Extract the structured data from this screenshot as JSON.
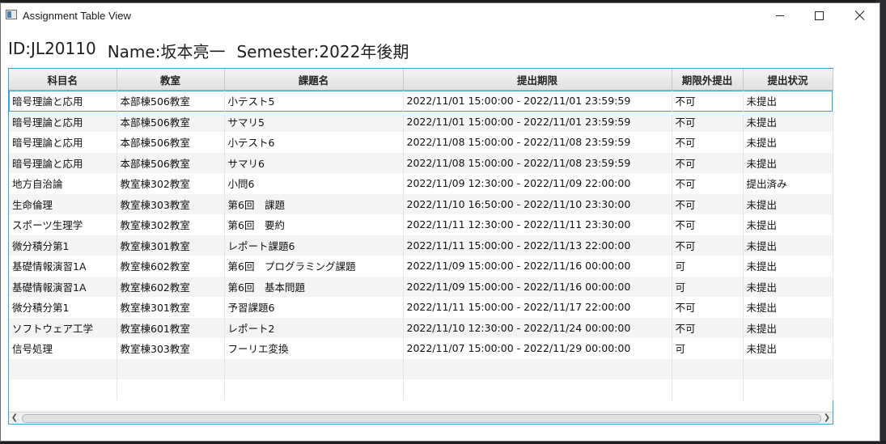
{
  "window": {
    "title": "Assignment Table View"
  },
  "student": {
    "id": "ID:JL20110",
    "name": "Name:坂本亮一",
    "semester": "Semester:2022年後期"
  },
  "table": {
    "columns": [
      "科目名",
      "教室",
      "課題名",
      "提出期限",
      "期限外提出",
      "提出状況"
    ],
    "rows": [
      [
        "暗号理論と応用",
        "本部棟506教室",
        "小テスト5",
        "2022/11/01 15:00:00 - 2022/11/01 23:59:59",
        "不可",
        "未提出"
      ],
      [
        "暗号理論と応用",
        "本部棟506教室",
        "サマリ5",
        "2022/11/01 15:00:00 - 2022/11/01 23:59:59",
        "不可",
        "未提出"
      ],
      [
        "暗号理論と応用",
        "本部棟506教室",
        "小テスト6",
        "2022/11/08 15:00:00 - 2022/11/08 23:59:59",
        "不可",
        "未提出"
      ],
      [
        "暗号理論と応用",
        "本部棟506教室",
        "サマリ6",
        "2022/11/08 15:00:00 - 2022/11/08 23:59:59",
        "不可",
        "未提出"
      ],
      [
        "地方自治論",
        "教室棟302教室",
        "小問6",
        "2022/11/09 12:30:00 - 2022/11/09 22:00:00",
        "不可",
        "提出済み"
      ],
      [
        "生命倫理",
        "教室棟303教室",
        "第6回　課題",
        "2022/11/10 16:50:00 - 2022/11/10 23:30:00",
        "不可",
        "未提出"
      ],
      [
        "スポーツ生理学",
        "教室棟302教室",
        "第6回　要約",
        "2022/11/11 12:30:00 - 2022/11/11 23:30:00",
        "不可",
        "未提出"
      ],
      [
        "微分積分第1",
        "教室棟301教室",
        "レポート課題6",
        "2022/11/11 15:00:00 - 2022/11/13 22:00:00",
        "不可",
        "未提出"
      ],
      [
        "基礎情報演習1A",
        "教室棟602教室",
        "第6回　プログラミング課題",
        "2022/11/09 15:00:00 - 2022/11/16 00:00:00",
        "可",
        "未提出"
      ],
      [
        "基礎情報演習1A",
        "教室棟602教室",
        "第6回　基本問題",
        "2022/11/09 15:00:00 - 2022/11/16 00:00:00",
        "可",
        "未提出"
      ],
      [
        "微分積分第1",
        "教室棟301教室",
        "予習課題6",
        "2022/11/11 15:00:00 - 2022/11/17 22:00:00",
        "不可",
        "未提出"
      ],
      [
        "ソフトウェア工学",
        "教室棟601教室",
        "レポート2",
        "2022/11/10 12:30:00 - 2022/11/24 00:00:00",
        "不可",
        "未提出"
      ],
      [
        "信号処理",
        "教室棟303教室",
        "フーリエ変換",
        "2022/11/07 15:00:00 - 2022/11/29 00:00:00",
        "可",
        "未提出"
      ]
    ],
    "empty_rows": 2,
    "selected_row": 0
  },
  "colors": {
    "accent": "#3aa4cf",
    "row_alt": "#f4f4f4"
  }
}
